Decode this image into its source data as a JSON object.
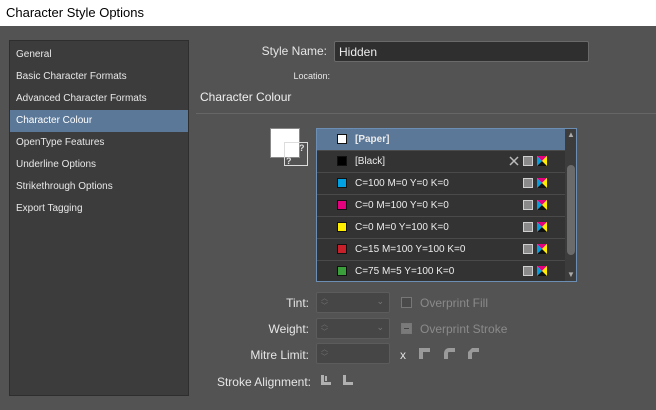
{
  "window": {
    "title": "Character Style Options"
  },
  "sidebar": {
    "items": [
      {
        "label": "General",
        "active": false
      },
      {
        "label": "Basic Character Formats",
        "active": false
      },
      {
        "label": "Advanced Character Formats",
        "active": false
      },
      {
        "label": "Character Colour",
        "active": true
      },
      {
        "label": "OpenType Features",
        "active": false
      },
      {
        "label": "Underline Options",
        "active": false
      },
      {
        "label": "Strikethrough Options",
        "active": false
      },
      {
        "label": "Export Tagging",
        "active": false
      }
    ]
  },
  "form": {
    "style_name_label": "Style Name:",
    "style_name_value": "Hidden",
    "location_label": "Location:"
  },
  "section": {
    "title": "Character Colour"
  },
  "swatches": [
    {
      "name": "[Paper]",
      "color": "#ffffff",
      "bold": true,
      "selected": true,
      "icons": []
    },
    {
      "name": "[Black]",
      "color": "#000000",
      "bold": false,
      "selected": false,
      "icons": [
        "no-edit-icon",
        "process-icon",
        "cmyk-icon"
      ]
    },
    {
      "name": "C=100 M=0 Y=0 K=0",
      "color": "#00a0e3",
      "bold": false,
      "selected": false,
      "icons": [
        "process-icon",
        "cmyk-icon"
      ]
    },
    {
      "name": "C=0 M=100 Y=0 K=0",
      "color": "#e5007e",
      "bold": false,
      "selected": false,
      "icons": [
        "process-icon",
        "cmyk-icon"
      ]
    },
    {
      "name": "C=0 M=0 Y=100 K=0",
      "color": "#ffee00",
      "bold": false,
      "selected": false,
      "icons": [
        "process-icon",
        "cmyk-icon"
      ]
    },
    {
      "name": "C=15 M=100 Y=100 K=0",
      "color": "#c8202a",
      "bold": false,
      "selected": false,
      "icons": [
        "process-icon",
        "cmyk-icon"
      ]
    },
    {
      "name": "C=75 M=5 Y=100 K=0",
      "color": "#3a9e3a",
      "bold": false,
      "selected": false,
      "icons": [
        "process-icon",
        "cmyk-icon"
      ]
    }
  ],
  "controls": {
    "tint_label": "Tint:",
    "weight_label": "Weight:",
    "mitre_label": "Mitre Limit:",
    "mitre_x": "x",
    "stroke_alignment_label": "Stroke Alignment:",
    "overprint_fill": "Overprint Fill",
    "overprint_stroke": "Overprint Stroke"
  },
  "colors": {
    "accent": "#5b7898",
    "panel": "#535353",
    "list_border": "#6d8eb4"
  }
}
